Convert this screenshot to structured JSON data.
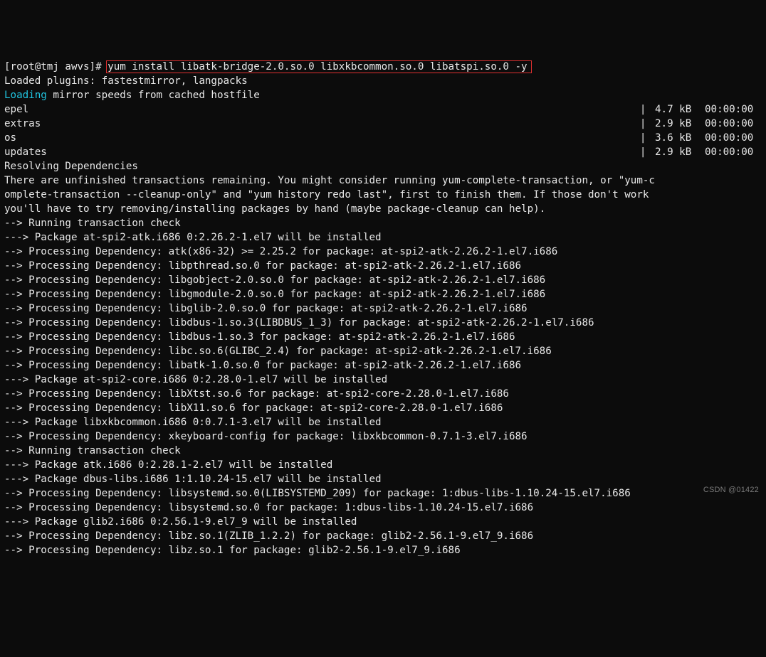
{
  "prompt": {
    "user_host": "[root@tmj awvs]#",
    "command": "yum install libatk-bridge-2.0.so.0 libxkbcommon.so.0 libatspi.so.0 -y"
  },
  "loaded_plugins": "Loaded plugins: fastestmirror, langpacks",
  "loading_word": "Loading",
  "loading_rest": " mirror speeds from cached hostfile",
  "repos": [
    {
      "name": "epel",
      "size": "4.7 kB",
      "time": "00:00:00"
    },
    {
      "name": "extras",
      "size": "2.9 kB",
      "time": "00:00:00"
    },
    {
      "name": "os",
      "size": "3.6 kB",
      "time": "00:00:00"
    },
    {
      "name": "updates",
      "size": "2.9 kB",
      "time": "00:00:00"
    }
  ],
  "lines": [
    "Resolving Dependencies",
    "There are unfinished transactions remaining. You might consider running yum-complete-transaction, or \"yum-c",
    "omplete-transaction --cleanup-only\" and \"yum history redo last\", first to finish them. If those don't work",
    "you'll have to try removing/installing packages by hand (maybe package-cleanup can help).",
    "--> Running transaction check",
    "---> Package at-spi2-atk.i686 0:2.26.2-1.el7 will be installed",
    "--> Processing Dependency: atk(x86-32) >= 2.25.2 for package: at-spi2-atk-2.26.2-1.el7.i686",
    "--> Processing Dependency: libpthread.so.0 for package: at-spi2-atk-2.26.2-1.el7.i686",
    "--> Processing Dependency: libgobject-2.0.so.0 for package: at-spi2-atk-2.26.2-1.el7.i686",
    "--> Processing Dependency: libgmodule-2.0.so.0 for package: at-spi2-atk-2.26.2-1.el7.i686",
    "--> Processing Dependency: libglib-2.0.so.0 for package: at-spi2-atk-2.26.2-1.el7.i686",
    "--> Processing Dependency: libdbus-1.so.3(LIBDBUS_1_3) for package: at-spi2-atk-2.26.2-1.el7.i686",
    "--> Processing Dependency: libdbus-1.so.3 for package: at-spi2-atk-2.26.2-1.el7.i686",
    "--> Processing Dependency: libc.so.6(GLIBC_2.4) for package: at-spi2-atk-2.26.2-1.el7.i686",
    "--> Processing Dependency: libatk-1.0.so.0 for package: at-spi2-atk-2.26.2-1.el7.i686",
    "---> Package at-spi2-core.i686 0:2.28.0-1.el7 will be installed",
    "--> Processing Dependency: libXtst.so.6 for package: at-spi2-core-2.28.0-1.el7.i686",
    "--> Processing Dependency: libX11.so.6 for package: at-spi2-core-2.28.0-1.el7.i686",
    "---> Package libxkbcommon.i686 0:0.7.1-3.el7 will be installed",
    "--> Processing Dependency: xkeyboard-config for package: libxkbcommon-0.7.1-3.el7.i686",
    "--> Running transaction check",
    "---> Package atk.i686 0:2.28.1-2.el7 will be installed",
    "---> Package dbus-libs.i686 1:1.10.24-15.el7 will be installed",
    "--> Processing Dependency: libsystemd.so.0(LIBSYSTEMD_209) for package: 1:dbus-libs-1.10.24-15.el7.i686",
    "--> Processing Dependency: libsystemd.so.0 for package: 1:dbus-libs-1.10.24-15.el7.i686",
    "---> Package glib2.i686 0:2.56.1-9.el7_9 will be installed",
    "--> Processing Dependency: libz.so.1(ZLIB_1.2.2) for package: glib2-2.56.1-9.el7_9.i686",
    "--> Processing Dependency: libz.so.1 for package: glib2-2.56.1-9.el7_9.i686"
  ],
  "watermark": "CSDN @01422"
}
